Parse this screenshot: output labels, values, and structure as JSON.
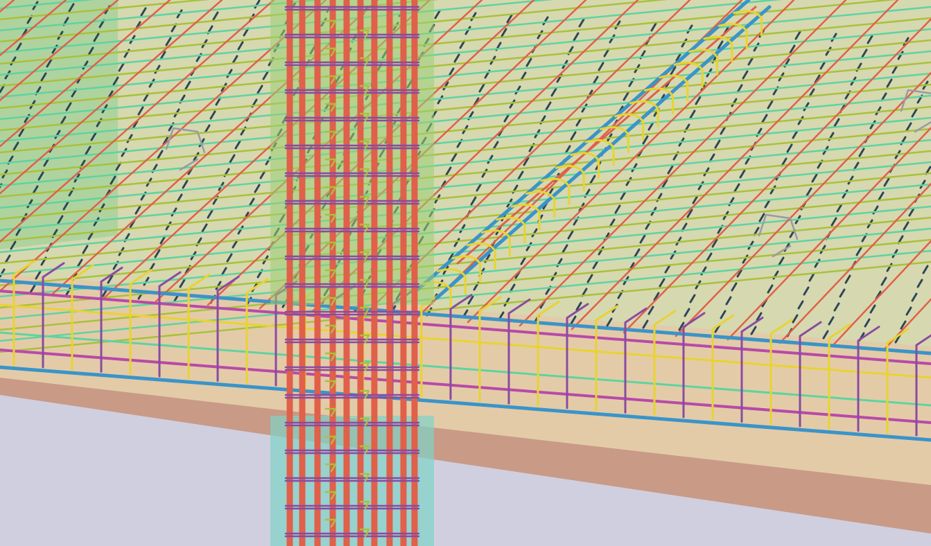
{
  "scene": {
    "description_visible_text": "",
    "colors": {
      "background": "#cfcfe0",
      "slab_top": "#d6d8b0",
      "slab_edge": "#e3cba8",
      "slab_soffit": "#c99a86",
      "column_glass_upper": "#9bcf74",
      "column_glass_lower": "#7fd3c6",
      "wall_glass": "#8fd08f",
      "rebar_red": "#e0604a",
      "rebar_yellow": "#e8d332",
      "rebar_blue": "#3a94c8",
      "rebar_green": "#5fd3a0",
      "rebar_olive": "#a9c13a",
      "rebar_magenta": "#b84aa8",
      "rebar_dark": "#2e4656",
      "chair_grey": "#9a9aa4",
      "stirrup_purple": "#8a4ba0"
    },
    "icons": [
      "chair-spacer-icon"
    ]
  }
}
